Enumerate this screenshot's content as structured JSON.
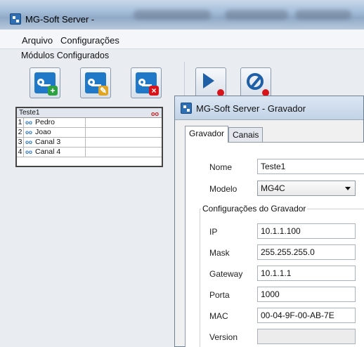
{
  "main_window": {
    "title": "MG-Soft Server -",
    "menu": [
      "Arquivo",
      "Configurações"
    ],
    "modules_label": "Módulos Configurados"
  },
  "toolbar": {
    "buttons": [
      {
        "name": "add-recorder",
        "icon": "recorder-add-icon"
      },
      {
        "name": "edit-recorder",
        "icon": "recorder-edit-icon"
      },
      {
        "name": "remove-recorder",
        "icon": "recorder-remove-icon"
      },
      {
        "name": "start",
        "icon": "play-icon"
      },
      {
        "name": "stop",
        "icon": "stop-icon"
      }
    ]
  },
  "module_list": {
    "header": "Teste1",
    "header_icon": "oo",
    "rows": [
      {
        "num": "1",
        "icon": "oo",
        "name": "Pedro"
      },
      {
        "num": "2",
        "icon": "oo",
        "name": "Joao"
      },
      {
        "num": "3",
        "icon": "oo",
        "name": "Canal 3"
      },
      {
        "num": "4",
        "icon": "oo",
        "name": "Canal 4"
      }
    ]
  },
  "dialog": {
    "title": "MG-Soft Server - Gravador",
    "tabs": [
      "Gravador",
      "Canais"
    ],
    "active_tab": "Gravador",
    "nome_label": "Nome",
    "nome_value": "Teste1",
    "modelo_label": "Modelo",
    "modelo_value": "MG4C",
    "group_label": "Configurações do Gravador",
    "ip_label": "IP",
    "ip_value": "10.1.1.100",
    "mask_label": "Mask",
    "mask_value": "255.255.255.0",
    "gateway_label": "Gateway",
    "gateway_value": "10.1.1.1",
    "porta_label": "Porta",
    "porta_value": "1000",
    "mac_label": "MAC",
    "mac_value": "00-04-9F-00-AB-7E",
    "version_label": "Version",
    "version_value": ""
  },
  "colors": {
    "accent": "#1f78c8",
    "badge_add": "#2ea043",
    "badge_edit": "#e0a526",
    "badge_remove": "#d8141b"
  }
}
